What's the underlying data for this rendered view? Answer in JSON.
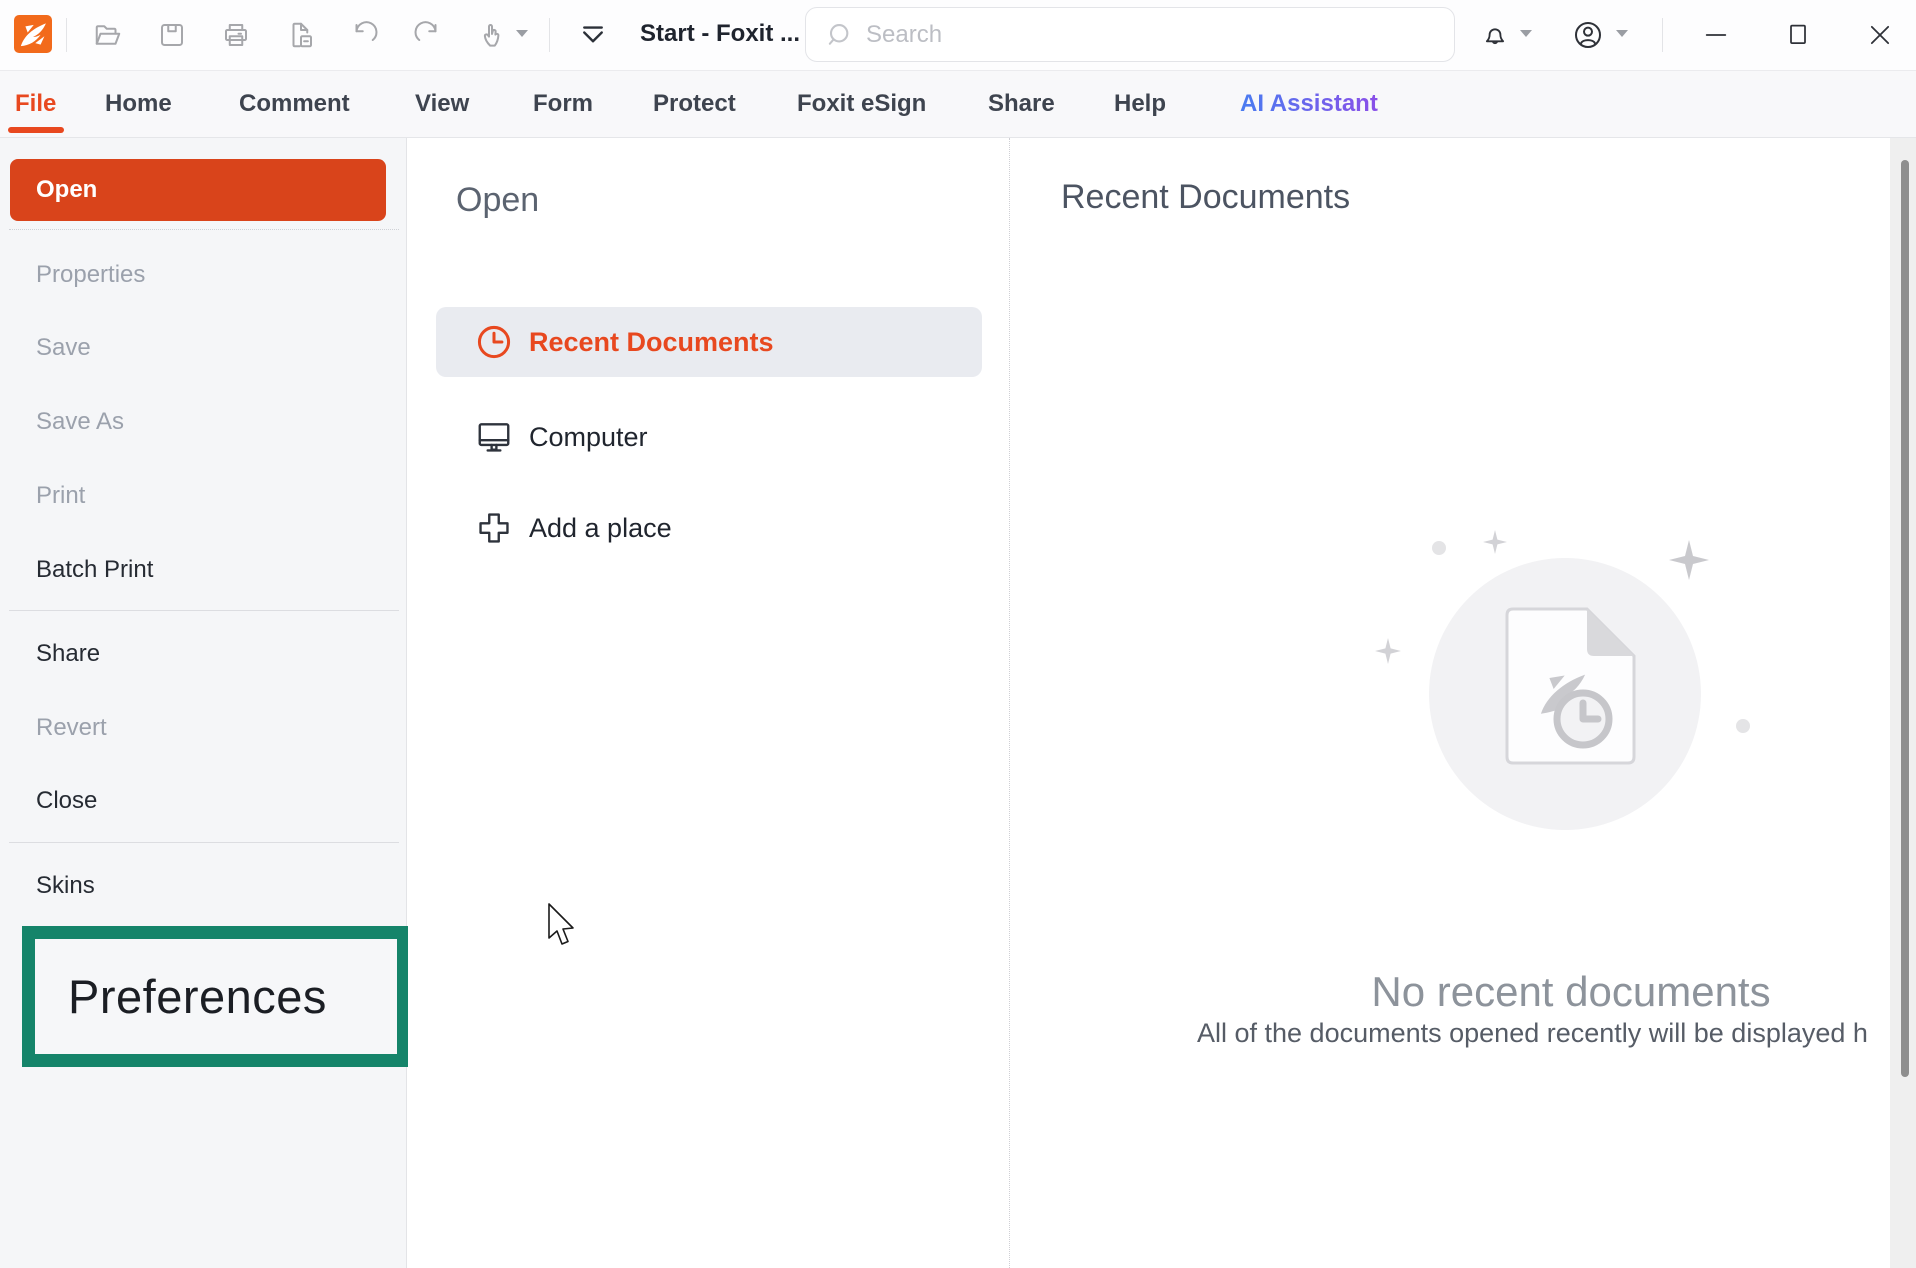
{
  "window": {
    "tab_title": "Start - Foxit ...",
    "search_placeholder": "Search"
  },
  "menubar": {
    "items": [
      {
        "label": "File",
        "active": true
      },
      {
        "label": "Home"
      },
      {
        "label": "Comment"
      },
      {
        "label": "View"
      },
      {
        "label": "Form"
      },
      {
        "label": "Protect"
      },
      {
        "label": "Foxit eSign"
      },
      {
        "label": "Share"
      },
      {
        "label": "Help"
      },
      {
        "label": "AI Assistant",
        "accent": true
      }
    ]
  },
  "sidebar": {
    "items": [
      {
        "label": "Open",
        "state": "active"
      },
      {
        "label": "Properties",
        "state": "disabled"
      },
      {
        "label": "Save",
        "state": "disabled"
      },
      {
        "label": "Save As",
        "state": "disabled"
      },
      {
        "label": "Print",
        "state": "disabled"
      },
      {
        "label": "Batch Print",
        "state": "enabled"
      },
      {
        "label": "Share",
        "state": "enabled"
      },
      {
        "label": "Revert",
        "state": "disabled"
      },
      {
        "label": "Close",
        "state": "enabled"
      },
      {
        "label": "Skins",
        "state": "enabled"
      },
      {
        "label": "Preferences",
        "state": "highlighted"
      }
    ]
  },
  "open_panel": {
    "title": "Open",
    "items": [
      {
        "label": "Recent Documents",
        "icon": "clock-icon",
        "selected": true
      },
      {
        "label": "Computer",
        "icon": "computer-icon",
        "selected": false
      },
      {
        "label": "Add a place",
        "icon": "plus-icon",
        "selected": false
      }
    ]
  },
  "recent_panel": {
    "title": "Recent Documents",
    "empty_title": "No recent documents",
    "empty_subtitle": "All of the documents opened recently will be displayed h"
  },
  "colors": {
    "accent": "#E8481F",
    "open_button": "#D9441B",
    "annotation_highlight": "#15846A",
    "ai_gradient_start": "#4A7CF0",
    "ai_gradient_end": "#8A4FE8"
  }
}
